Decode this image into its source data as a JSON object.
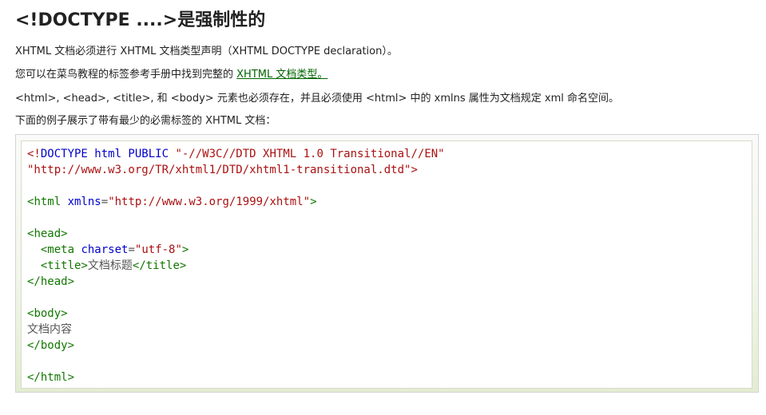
{
  "heading": "<!DOCTYPE ....>是强制性的",
  "paragraphs": {
    "p1": "XHTML 文档必须进行 XHTML 文档类型声明（XHTML DOCTYPE declaration）。",
    "p2_text": "您可以在菜鸟教程的标签参考手册中找到完整的 ",
    "p2_link": "XHTML 文档类型。",
    "p3": "<html>, <head>, <title>, 和 <body> 元素也必须存在，并且必须使用 <html> 中的 xmlns 属性为文档规定 xml 命名空间。",
    "p4": "下面的例子展示了带有最少的必需标签的 XHTML 文档："
  },
  "code": {
    "doctype_open": "<!",
    "doctype_kw": "DOCTYPE html PUBLIC",
    "doctype_public": "\"-//W3C//DTD XHTML 1.0 Transitional//EN\"",
    "doctype_system": "\"http://www.w3.org/TR/xhtml1/DTD/xhtml1-transitional.dtd\"",
    "doctype_close": ">",
    "lt": "<",
    "gt": ">",
    "lt_slash": "</",
    "eq": "=",
    "html_tag": "html",
    "xmlns_attr": "xmlns",
    "xmlns_value": "\"http://www.w3.org/1999/xhtml\"",
    "head_tag": "head",
    "meta_tag": "meta",
    "charset_attr": "charset",
    "charset_value": "\"utf-8\"",
    "title_tag": "title",
    "title_text": "文档标题",
    "body_tag": "body",
    "body_text": "文档内容"
  },
  "colors": {
    "tag": "#117700",
    "attribute": "#0000cc",
    "string": "#aa1111",
    "link": "#006400"
  }
}
